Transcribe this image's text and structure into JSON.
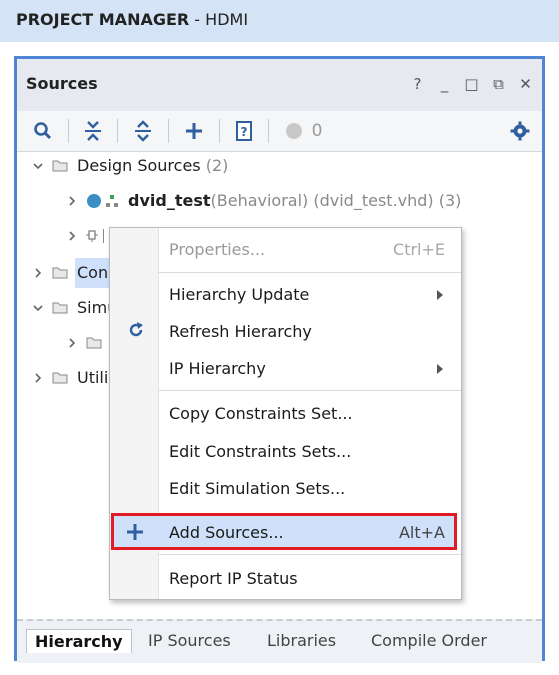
{
  "header": {
    "title_bold": "PROJECT MANAGER",
    "title_rest": " - HDMI",
    "bg": "#d5e3f6"
  },
  "panel": {
    "title": "Sources",
    "controls": [
      "?",
      "_",
      "□",
      "⧉",
      "✕"
    ],
    "toolbar": {
      "badge_count": "0"
    },
    "tree": {
      "design_sources": {
        "label": "Design Sources",
        "count": "(2)"
      },
      "dvid_test": {
        "name": "dvid_test",
        "detail": "(Behavioral) (dvid_test.vhd) (3)"
      },
      "constraints_partial": "Con",
      "simulation_partial": "Simu",
      "utility_partial": "Utili"
    },
    "tabs": [
      "Hierarchy",
      "IP Sources",
      "Libraries",
      "Compile Order"
    ]
  },
  "context_menu": {
    "properties": "Properties...",
    "properties_shortcut": "Ctrl+E",
    "hierarchy_update": "Hierarchy Update",
    "refresh_hierarchy": "Refresh Hierarchy",
    "ip_hierarchy": "IP Hierarchy",
    "copy_constraints_set": "Copy Constraints Set...",
    "edit_constraints_sets": "Edit Constraints Sets...",
    "edit_simulation_sets": "Edit Simulation Sets...",
    "add_sources": "Add Sources...",
    "add_sources_shortcut": "Alt+A",
    "report_ip_status": "Report IP Status"
  },
  "colors": {
    "accent": "#4f86d3",
    "highlight_border": "#e01b24",
    "selection": "#cfe1fa",
    "icon_blue": "#2f5f9e"
  }
}
